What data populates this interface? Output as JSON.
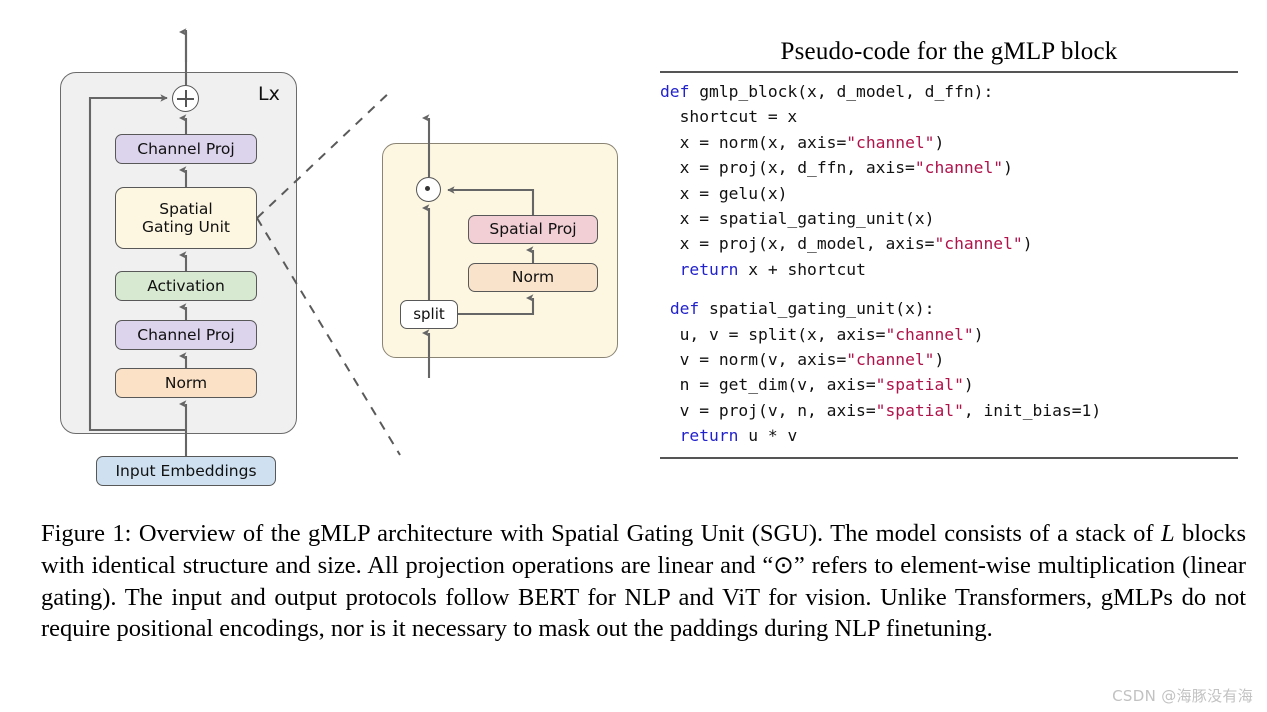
{
  "diagram": {
    "loop_label": "Lx",
    "blocks": {
      "channel_proj_top": "Channel Proj",
      "spatial_gating_unit": "Spatial\nGating Unit",
      "activation": "Activation",
      "channel_proj_bottom": "Channel Proj",
      "norm": "Norm",
      "input_embeddings": "Input Embeddings"
    },
    "detail": {
      "spatial_proj": "Spatial Proj",
      "norm": "Norm",
      "split": "split"
    },
    "operators": {
      "residual_add": "⊕",
      "elementwise_mul": "⊙"
    },
    "colors": {
      "channel_proj": "#dcd3ec",
      "spatial_gating_unit": "#fdf7e1",
      "activation": "#d7e9d1",
      "norm": "#fbe1c6",
      "input_embeddings": "#cfe1f1",
      "spatial_proj": "#f1cfd5",
      "detail_norm": "#fae3cb",
      "outer_block": "#f0f0f0",
      "split": "#ffffff"
    }
  },
  "code_panel": {
    "title": "Pseudo-code for the gMLP block",
    "lines": [
      [
        {
          "t": "def ",
          "c": "kw"
        },
        {
          "t": "gmlp_block(x, d_model, d_ffn):",
          "c": ""
        }
      ],
      [
        {
          "t": "  shortcut = x",
          "c": ""
        }
      ],
      [
        {
          "t": "  x = norm(x, axis=",
          "c": ""
        },
        {
          "t": "\"channel\"",
          "c": "str"
        },
        {
          "t": ")",
          "c": ""
        }
      ],
      [
        {
          "t": "  x = proj(x, d_ffn, axis=",
          "c": ""
        },
        {
          "t": "\"channel\"",
          "c": "str"
        },
        {
          "t": ")",
          "c": ""
        }
      ],
      [
        {
          "t": "  x = gelu(x)",
          "c": ""
        }
      ],
      [
        {
          "t": "  x = spatial_gating_unit(x)",
          "c": ""
        }
      ],
      [
        {
          "t": "  x = proj(x, d_model, axis=",
          "c": ""
        },
        {
          "t": "\"channel\"",
          "c": "str"
        },
        {
          "t": ")",
          "c": ""
        }
      ],
      [
        {
          "t": "  ",
          "c": ""
        },
        {
          "t": "return",
          "c": "kw"
        },
        {
          "t": " x + shortcut",
          "c": ""
        }
      ],
      [],
      [
        {
          "t": " ",
          "c": ""
        },
        {
          "t": "def ",
          "c": "kw"
        },
        {
          "t": "spatial_gating_unit(x):",
          "c": ""
        }
      ],
      [
        {
          "t": "  u, v = split(x, axis=",
          "c": ""
        },
        {
          "t": "\"channel\"",
          "c": "str"
        },
        {
          "t": ")",
          "c": ""
        }
      ],
      [
        {
          "t": "  v = norm(v, axis=",
          "c": ""
        },
        {
          "t": "\"channel\"",
          "c": "str"
        },
        {
          "t": ")",
          "c": ""
        }
      ],
      [
        {
          "t": "  n = get_dim(v, axis=",
          "c": ""
        },
        {
          "t": "\"spatial\"",
          "c": "str"
        },
        {
          "t": ")",
          "c": ""
        }
      ],
      [
        {
          "t": "  v = proj(v, n, axis=",
          "c": ""
        },
        {
          "t": "\"spatial\"",
          "c": "str"
        },
        {
          "t": ", init_bias=1)",
          "c": ""
        }
      ],
      [
        {
          "t": "  ",
          "c": ""
        },
        {
          "t": "return",
          "c": "kw"
        },
        {
          "t": " u * v",
          "c": ""
        }
      ]
    ],
    "colors": {
      "keyword": "#2222cc",
      "string": "#b0124a",
      "rule": "#555555"
    }
  },
  "caption": {
    "text_parts": [
      {
        "t": "Figure 1: Overview of the gMLP architecture with Spatial Gating Unit (SGU). The model consists of a stack of ",
        "style": "normal"
      },
      {
        "t": "L",
        "style": "italic"
      },
      {
        "t": " blocks with identical structure and size. All projection operations are linear and “⊙” refers to element-wise multiplication (linear gating). The input and output protocols follow BERT for NLP and ViT for vision. Unlike Transformers, gMLPs do not require positional encodings, nor is it necessary to mask out the paddings during NLP finetuning.",
        "style": "normal"
      }
    ]
  },
  "watermark": {
    "text": "CSDN @海豚没有海"
  }
}
